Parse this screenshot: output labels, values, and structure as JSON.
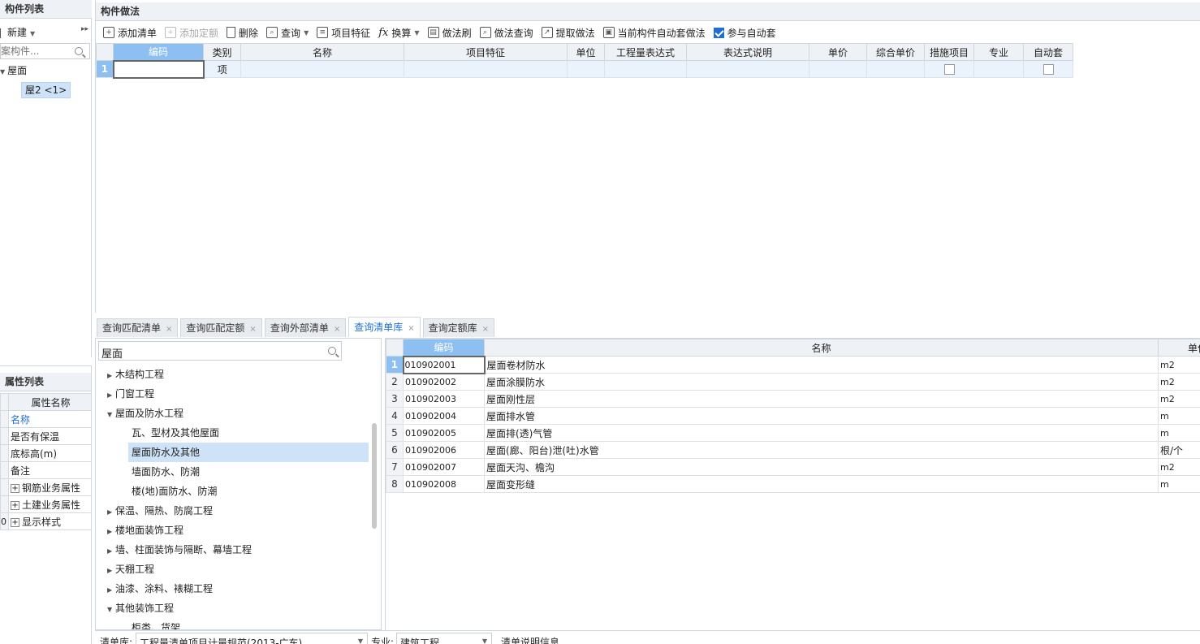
{
  "left_panel": {
    "title": "构件列表",
    "new_label": "新建",
    "search_placeholder": "案构件...",
    "tree": {
      "root": "屋面",
      "child": "屋2 <1>"
    }
  },
  "property_panel": {
    "title": "属性列表",
    "header": "属性名称",
    "rows": [
      {
        "num": "",
        "label": "名称"
      },
      {
        "num": "",
        "label": "是否有保温"
      },
      {
        "num": "",
        "label": "底标高(m)"
      },
      {
        "num": "",
        "label": "备注"
      },
      {
        "num": "",
        "label": "钢筋业务属性"
      },
      {
        "num": "",
        "label": "土建业务属性"
      },
      {
        "num": "0",
        "label": "显示样式"
      }
    ]
  },
  "method_panel": {
    "title": "构件做法",
    "toolbar": {
      "add_list": "添加清单",
      "add_quota": "添加定额",
      "delete": "删除",
      "query": "查询",
      "item_feature": "项目特征",
      "convert": "换算",
      "method_brush": "做法刷",
      "method_query": "做法查询",
      "extract_method": "提取做法",
      "auto_method": "当前构件自动套做法",
      "join_auto": "参与自动套"
    },
    "columns": [
      "编码",
      "类别",
      "名称",
      "项目特征",
      "单位",
      "工程量表达式",
      "表达式说明",
      "单价",
      "综合单价",
      "措施项目",
      "专业",
      "自动套"
    ],
    "row": {
      "num": "1",
      "code": "",
      "type": "项",
      "name": "",
      "feature": "",
      "unit": ""
    }
  },
  "tabs": [
    {
      "label": "查询匹配清单"
    },
    {
      "label": "查询匹配定额"
    },
    {
      "label": "查询外部清单"
    },
    {
      "label": "查询清单库"
    },
    {
      "label": "查询定额库"
    }
  ],
  "tab_close": "×",
  "library_tree": {
    "search_value": "屋面",
    "nodes": [
      {
        "label": "木结构工程"
      },
      {
        "label": "门窗工程"
      },
      {
        "label": "屋面及防水工程"
      },
      {
        "label": "瓦、型材及其他屋面"
      },
      {
        "label": "屋面防水及其他"
      },
      {
        "label": "墙面防水、防潮"
      },
      {
        "label": "楼(地)面防水、防潮"
      },
      {
        "label": "保温、隔热、防腐工程"
      },
      {
        "label": "楼地面装饰工程"
      },
      {
        "label": "墙、柱面装饰与隔断、幕墙工程"
      },
      {
        "label": "天棚工程"
      },
      {
        "label": "油漆、涂料、裱糊工程"
      },
      {
        "label": "其他装饰工程"
      },
      {
        "label": "柜类、货架"
      }
    ]
  },
  "library_grid": {
    "columns": [
      "编码",
      "名称",
      "单位"
    ],
    "rows": [
      {
        "num": "1",
        "code": "010902001",
        "name": "屋面卷材防水",
        "unit": "m2"
      },
      {
        "num": "2",
        "code": "010902002",
        "name": "屋面涂膜防水",
        "unit": "m2"
      },
      {
        "num": "3",
        "code": "010902003",
        "name": "屋面刚性层",
        "unit": "m2"
      },
      {
        "num": "4",
        "code": "010902004",
        "name": "屋面排水管",
        "unit": "m"
      },
      {
        "num": "5",
        "code": "010902005",
        "name": "屋面排(透)气管",
        "unit": "m"
      },
      {
        "num": "6",
        "code": "010902006",
        "name": "屋面(廊、阳台)泄(吐)水管",
        "unit": "根/个"
      },
      {
        "num": "7",
        "code": "010902007",
        "name": "屋面天沟、檐沟",
        "unit": "m2"
      },
      {
        "num": "8",
        "code": "010902008",
        "name": "屋面变形缝",
        "unit": "m"
      }
    ]
  },
  "status_bar": {
    "library_label": "清单库:",
    "library_value": "工程量清单项目计量规范(2013-广东)",
    "major_label": "专业:",
    "major_value": "建筑工程",
    "desc_label": "清单说明信息"
  },
  "colors": {
    "accent": "#1f6fd1",
    "header_highlight": "#8dc0f0",
    "selection": "#cfe3f8"
  }
}
